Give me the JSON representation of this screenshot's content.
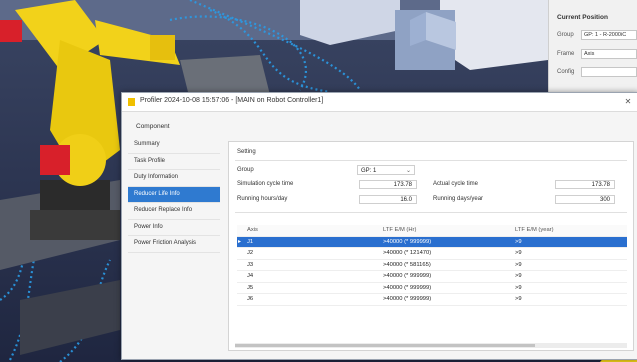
{
  "dialog": {
    "title": "Profiler 2024-10-08 15:57:06 - [MAIN on Robot Controller1]",
    "component_label": "Component",
    "nav_items": [
      {
        "label": "Summary",
        "active": false
      },
      {
        "label": "Task Profile",
        "active": false
      },
      {
        "label": "Duty Information",
        "active": false
      },
      {
        "label": "Reducer Life Info",
        "active": true
      },
      {
        "label": "Reducer Replace Info",
        "active": false
      },
      {
        "label": "Power Info",
        "active": false
      },
      {
        "label": "Power Friction Analysis",
        "active": false
      }
    ],
    "setting": {
      "section_label": "Setting",
      "group_label": "Group",
      "group_value": "GP: 1",
      "sim_cycle_label": "Simulation cycle time",
      "sim_cycle_value": "173.78",
      "actual_cycle_label": "Actual cycle time",
      "actual_cycle_value": "173.78",
      "hours_label": "Running hours/day",
      "hours_value": "16.0",
      "days_label": "Running days/year",
      "days_value": "300"
    },
    "table": {
      "columns": [
        "Axis",
        "LTF E/M (Hr)",
        "LTF E/M (year)"
      ],
      "rows": [
        {
          "axis": "J1",
          "hr": ">40000 (* 999999)",
          "year": ">9",
          "selected": true
        },
        {
          "axis": "J2",
          "hr": ">40000 (* 121470)",
          "year": ">9",
          "selected": false
        },
        {
          "axis": "J3",
          "hr": ">40000 (* 581165)",
          "year": ">9",
          "selected": false
        },
        {
          "axis": "J4",
          "hr": ">40000 (* 999999)",
          "year": ">9",
          "selected": false
        },
        {
          "axis": "J5",
          "hr": ">40000 (* 999999)",
          "year": ">9",
          "selected": false
        },
        {
          "axis": "J6",
          "hr": ">40000 (* 999999)",
          "year": ">9",
          "selected": false
        }
      ],
      "row_marker": "▸"
    }
  },
  "properties": {
    "header": "Current Position",
    "rows": [
      {
        "label": "Group",
        "value": "GP: 1 - R-2000iC"
      },
      {
        "label": "Frame",
        "value": "Axis"
      },
      {
        "label": "Config",
        "value": ""
      }
    ]
  },
  "icons": {
    "close": "close-icon",
    "app": "profiler-app-icon",
    "dropdown": "chevron-down-icon"
  },
  "colors": {
    "accent": "#2f7ad0",
    "robot_yellow": "#f2d21a",
    "robot_red": "#d8202a",
    "trail_blue": "#2a9be6"
  }
}
